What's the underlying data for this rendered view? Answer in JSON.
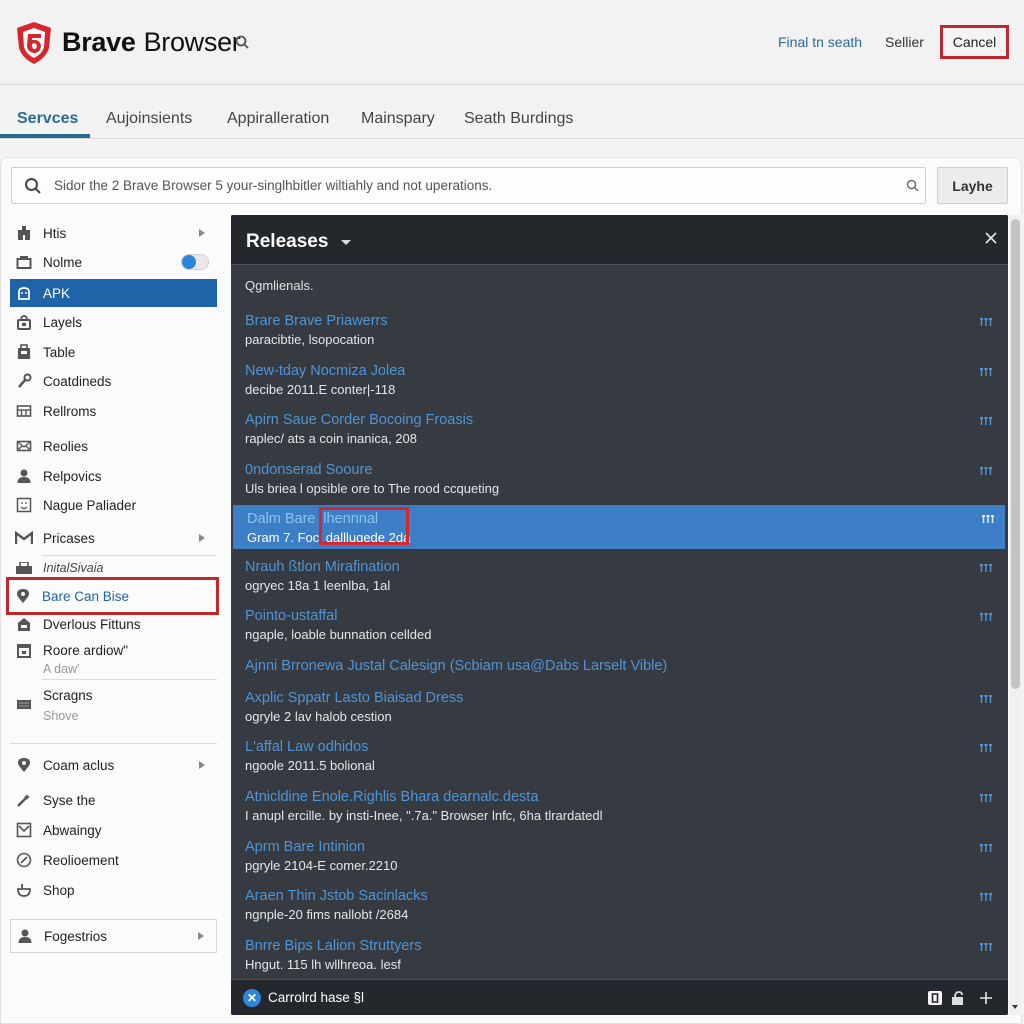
{
  "header": {
    "brand_bold": "Brave",
    "brand_light": "Browser",
    "links": [
      "Final tn seath",
      "Sellier"
    ],
    "cancel_label": "Cancel"
  },
  "tabs": [
    {
      "label": "Servces",
      "active": true
    },
    {
      "label": "Aujoinsients",
      "active": false
    },
    {
      "label": "Appiralleration",
      "active": false
    },
    {
      "label": "Mainspary",
      "active": false
    },
    {
      "label": "Seath Burdings",
      "active": false
    }
  ],
  "search": {
    "placeholder": "Sidor the 2 Brave Browser 5 your-singlhbitler wiltiahly and not uperations.",
    "button_label": "Layhe"
  },
  "sidebar": {
    "items": [
      {
        "label": "Htis",
        "icon": "building-icon",
        "arrow": true
      },
      {
        "label": "Nolme",
        "icon": "tray-icon",
        "toggle": true,
        "toggle_on": true
      },
      {
        "label": "APK",
        "icon": "android-icon",
        "selected": true
      },
      {
        "label": "Layels",
        "icon": "lock-icon"
      },
      {
        "label": "Table",
        "icon": "bag-icon"
      },
      {
        "label": "Coatdineds",
        "icon": "wrench-icon"
      },
      {
        "label": "Rellroms",
        "icon": "grid-icon"
      },
      {
        "label": "Reolies",
        "icon": "mail-icon"
      },
      {
        "label": "Relpovics",
        "icon": "person-icon"
      },
      {
        "label": "Nague Paliader",
        "icon": "face-icon"
      },
      {
        "label": "Pricases",
        "icon": "gmail-icon",
        "arrow": true
      },
      {
        "label": "Bare Can Bise",
        "icon": "location-pin-icon",
        "highlight": true
      },
      {
        "label": "Dverlous Fittuns",
        "icon": "home-icon"
      },
      {
        "label": "Roore ardiow\"",
        "icon": "calendar-icon",
        "sub": "A daw'"
      },
      {
        "label": "Scragns",
        "icon": "keyboard-icon",
        "sub": "Shove"
      },
      {
        "label": "Coam aclus",
        "icon": "location-pin-icon",
        "arrow": true
      },
      {
        "label": "Syse the",
        "icon": "wand-icon"
      },
      {
        "label": "Abwaingy",
        "icon": "checkbox-icon"
      },
      {
        "label": "Reolioement",
        "icon": "compass-icon"
      },
      {
        "label": "Shop",
        "icon": "pot-icon"
      },
      {
        "label": "Fogestrios",
        "icon": "person-icon",
        "arrow": true,
        "boxed": true
      }
    ],
    "italic_label": "InitalSivaia"
  },
  "releases": {
    "title": "Releases",
    "subtitle": "Qgmlienals.",
    "items": [
      {
        "title": "Brare Brave Priawerrs",
        "subtitle": "paracibtie, lsopocation"
      },
      {
        "title": "New-tday Nocmiza Jolea",
        "subtitle": "decibe 2011.E conter|-118"
      },
      {
        "title": "Apirn Saue Corder Bocoing Froasis",
        "subtitle": "raplec/ ats a coin inanica, 208"
      },
      {
        "title": "0ndonserad Sooure",
        "subtitle": "Uls briea l opsible ore to The rood ccqueting"
      },
      {
        "title": "Dalm Bare |lhennnal",
        "subtitle": "Gram 7. Focl dalllugede 2da",
        "selected": true
      },
      {
        "title": "Nrauh ßtlon Mirafination",
        "subtitle": "ogryec 18a 1 leenlba, 1al"
      },
      {
        "title": "Pointo-ustaffal",
        "subtitle": "ngaple, loable bunnation cellded"
      },
      {
        "title": "Ajnni Brronewa Justal Calesign (Scbiam usa@Dabs Larselt Vible)",
        "subtitle": null
      },
      {
        "title": "Axplic Sppatr Lasto Biaisad Dress",
        "subtitle": "ogryle 2 lav halob cestion"
      },
      {
        "title": "L'affal Law odhidos",
        "subtitle": "ngoole 2011.5 bolional"
      },
      {
        "title": "Atnicldine Enole.Righlis Bhara dearnalc.desta",
        "subtitle": "I anupl ercille. by insti-Inee, \".7a.\" Browser lnfc, 6ha tlrardatedl"
      },
      {
        "title": "Aprm Bare Intinion",
        "subtitle": "pgryle 2104-E comer.2210"
      },
      {
        "title": "Araen Thin Jstob Sacinlacks",
        "subtitle": "ngnple-20 fims nallobt /2684"
      },
      {
        "title": "Bnrre Bips Lalion Struttyers",
        "subtitle": "Hngut. 115 lh wllhreoa. lesf"
      }
    ],
    "footer_text": "Carrolrd hase §l",
    "footer_icon_glyph": "✕"
  },
  "colors": {
    "accent": "#2a6a96",
    "selected_blue": "#1f64a8",
    "highlight_red": "#c4262e",
    "panel_bg": "#363b42",
    "link_blue": "#4f94d4"
  }
}
